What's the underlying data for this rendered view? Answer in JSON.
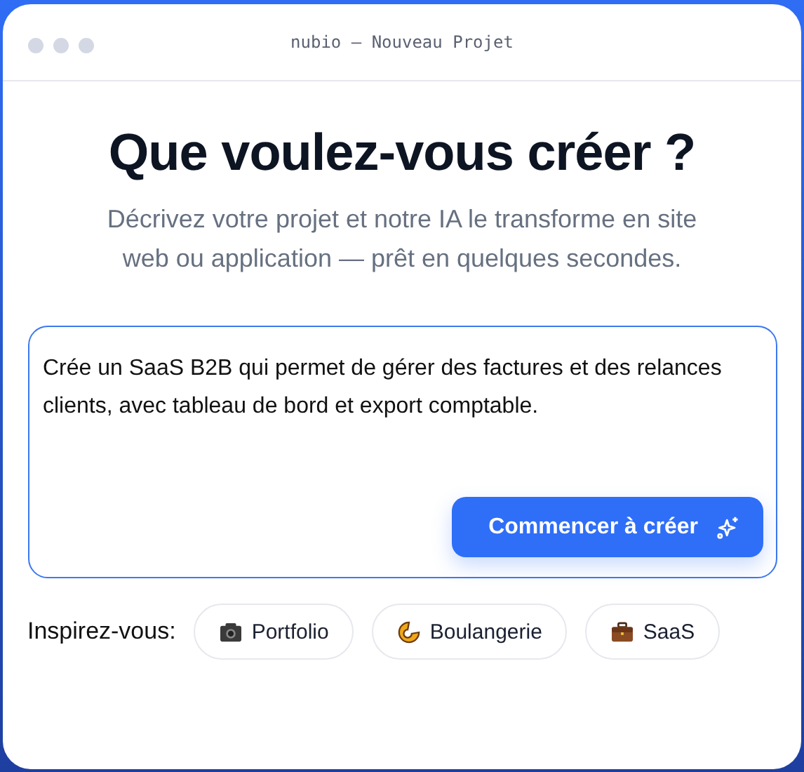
{
  "window": {
    "title": "nubio — Nouveau Projet"
  },
  "heading": "Que voulez-vous créer ?",
  "subtitle": "Décrivez votre projet et notre IA le transforme en site web ou application — prêt en quelques secondes.",
  "prompt": {
    "value": "Crée un SaaS B2B qui permet de gérer des factures et des relances clients, avec tableau de bord et export comptable."
  },
  "submit_button": "Commencer à créer",
  "inspiration": {
    "label": "Inspirez-vous:",
    "chips": [
      {
        "label": "Portfolio"
      },
      {
        "label": "Boulangerie"
      },
      {
        "label": "SaaS"
      }
    ]
  }
}
